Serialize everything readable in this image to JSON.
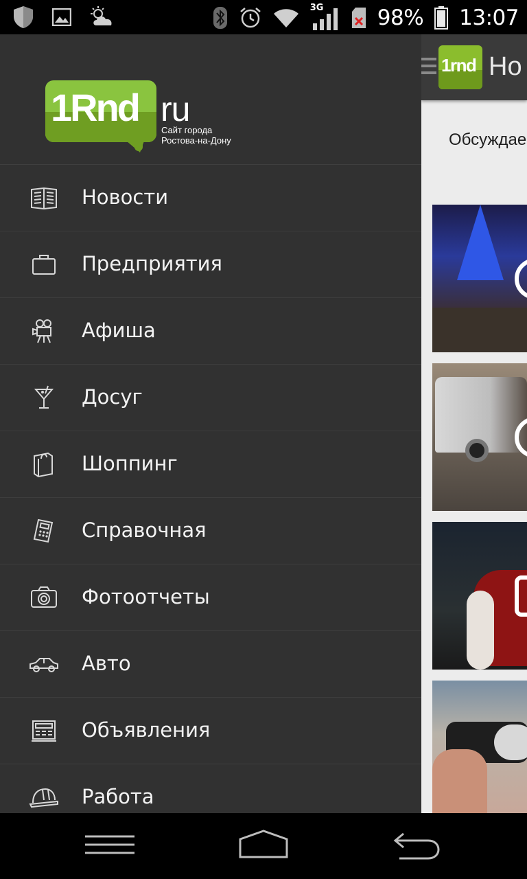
{
  "status_bar": {
    "battery_percent": "98%",
    "time": "13:07",
    "network": "3G",
    "icons": [
      "shield-icon",
      "image-icon",
      "weather-icon",
      "bluetooth-icon",
      "alarm-icon",
      "wifi-icon",
      "signal-icon",
      "no-sim-icon",
      "battery-icon"
    ]
  },
  "drawer": {
    "logo": {
      "brand": "1Rnd",
      "suffix": "ru",
      "tagline_1": "Сайт города",
      "tagline_2": "Ростова-на-Дону"
    },
    "items": [
      {
        "label": "Новости",
        "icon": "newspaper-icon"
      },
      {
        "label": "Предприятия",
        "icon": "briefcase-icon"
      },
      {
        "label": "Афиша",
        "icon": "movie-camera-icon"
      },
      {
        "label": "Досуг",
        "icon": "cocktail-icon"
      },
      {
        "label": "Шоппинг",
        "icon": "shopping-bag-icon"
      },
      {
        "label": "Справочная",
        "icon": "phone-icon"
      },
      {
        "label": "Фотоотчеты",
        "icon": "camera-icon"
      },
      {
        "label": "Авто",
        "icon": "car-icon"
      },
      {
        "label": "Объявления",
        "icon": "cash-register-icon"
      },
      {
        "label": "Работа",
        "icon": "hard-hat-icon"
      }
    ]
  },
  "main": {
    "app_logo_text": "1rnd",
    "title": "Но",
    "subtitle": "Обсуждае"
  },
  "nav_bar": {
    "icons": [
      "recent-apps-icon",
      "home-icon",
      "back-icon"
    ]
  },
  "colors": {
    "drawer_bg": "#313131",
    "brand_green": "#8ac43f",
    "brand_green_dark": "#6f9e22",
    "toolbar_bg": "#3a3a3a"
  }
}
